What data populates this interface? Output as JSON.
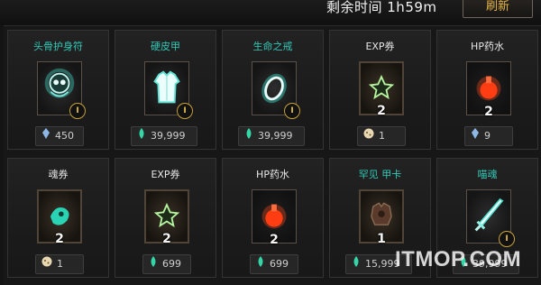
{
  "header": {
    "timer_label": "剩余时间 1h59m",
    "refresh_label": "刷新"
  },
  "items": [
    {
      "name": "头骨护身符",
      "icon": "skull-amulet-icon",
      "quantity": "",
      "rank": "I",
      "price_currency": "crystal-icon",
      "price": "450"
    },
    {
      "name": "硬皮甲",
      "icon": "leather-armor-icon",
      "quantity": "",
      "rank": "I",
      "price_currency": "soul-flame-icon",
      "price": "39,999"
    },
    {
      "name": "生命之戒",
      "icon": "ring-icon",
      "quantity": "",
      "rank": "I",
      "price_currency": "soul-flame-icon",
      "price": "39,999"
    },
    {
      "name": "EXP券",
      "icon": "exp-ticket-icon",
      "quantity": "2",
      "rank": "",
      "price_currency": "cookie-icon",
      "price": "1"
    },
    {
      "name": "HP药水",
      "icon": "hp-potion-icon",
      "quantity": "2",
      "rank": "",
      "price_currency": "crystal-icon",
      "price": "9"
    },
    {
      "name": "魂券",
      "icon": "soul-ticket-icon",
      "quantity": "2",
      "rank": "",
      "price_currency": "cookie-icon",
      "price": "1"
    },
    {
      "name": "EXP券",
      "icon": "exp-ticket-icon",
      "quantity": "2",
      "rank": "",
      "price_currency": "soul-flame-icon",
      "price": "699"
    },
    {
      "name": "HP药水",
      "icon": "hp-potion-icon",
      "quantity": "2",
      "rank": "",
      "price_currency": "soul-flame-icon",
      "price": "699"
    },
    {
      "name": "罕见  甲卡",
      "icon": "armor-card-icon",
      "quantity": "1",
      "rank": "",
      "price_currency": "soul-flame-icon",
      "price": "15,999"
    },
    {
      "name": "喵魂",
      "icon": "sword-icon",
      "quantity": "",
      "rank": "I",
      "price_currency": "soul-flame-icon",
      "price": "39,999"
    }
  ],
  "colors": {
    "teal": "#34c9b8",
    "gold": "#e6b447",
    "red": "#ff4a1c"
  },
  "watermark": "ITMOP.COM"
}
